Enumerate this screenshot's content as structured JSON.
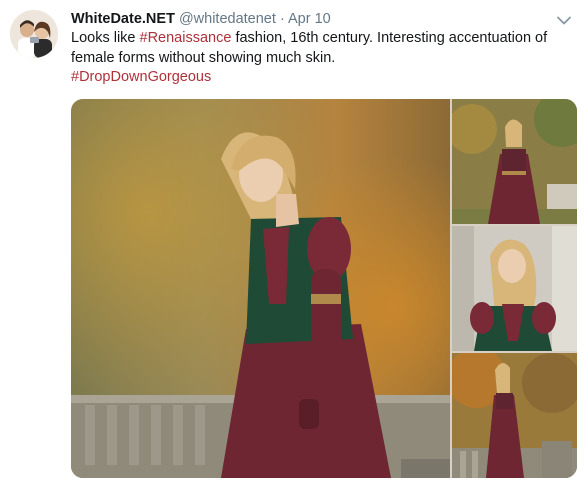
{
  "tweet": {
    "display_name": "WhiteDate.NET",
    "handle": "@whitedatenet",
    "separator": "·",
    "time": "Apr 10",
    "text_before": "Looks like ",
    "hashtag_1": "#Renaissance",
    "text_after": " fashion, 16th century. Interesting accentuation of female forms without showing much skin.",
    "hashtag_2": "#DropDownGorgeous"
  },
  "media": {
    "main_photo_icon": "photo-woman-renaissance-dress",
    "thumbnails": [
      "photo-woman-full-dress-garden",
      "photo-woman-portrait-columns",
      "photo-woman-dress-autumn-trees"
    ]
  },
  "colors": {
    "text": "#14171a",
    "muted": "#657786",
    "hashtag": "#b0303a",
    "dress_burgundy": "#6e2632",
    "vest_green": "#1f4a36",
    "hair_blonde": "#d8b679",
    "autumn_orange": "#b5782c"
  }
}
